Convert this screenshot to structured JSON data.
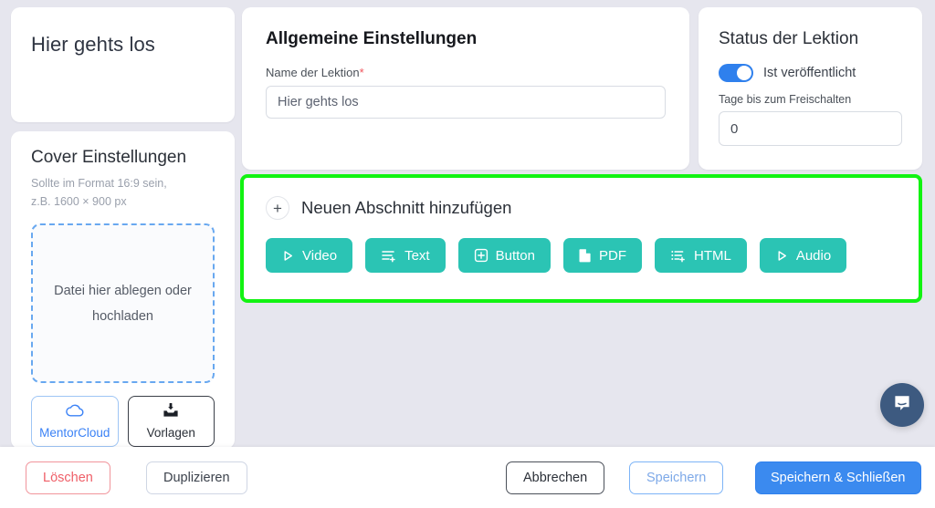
{
  "lesson": {
    "title": "Hier gehts los"
  },
  "cover": {
    "heading": "Cover Einstellungen",
    "hint_line1": "Sollte im Format 16:9 sein,",
    "hint_line2": "z.B. 1600 × 900 px",
    "dropzone_text": "Datei hier ablegen oder hochladen",
    "buttons": [
      {
        "label": "MentorCloud",
        "icon": "cloud-icon"
      },
      {
        "label": "Vorlagen",
        "icon": "template-upload-icon"
      }
    ]
  },
  "general": {
    "heading": "Allgemeine Einstellungen",
    "name_label": "Name der Lektion",
    "required_marker": "*",
    "name_value": "Hier gehts los",
    "name_placeholder": "Name der Lektion"
  },
  "status": {
    "heading": "Status der Lektion",
    "publish_label": "Ist veröffentlicht",
    "publish_on": true,
    "days_label": "Tage bis zum Freischalten",
    "days_value": "0",
    "days_placeholder": "0"
  },
  "add_section": {
    "label": "Neuen Abschnitt hinzufügen",
    "plus_glyph": "+",
    "highlight_color": "#12f312",
    "button_color": "#2bc4b4",
    "buttons": [
      {
        "label": "Video",
        "icon": "play-icon"
      },
      {
        "label": "Text",
        "icon": "text-lines-plus-icon"
      },
      {
        "label": "Button",
        "icon": "plus-square-icon"
      },
      {
        "label": "PDF",
        "icon": "file-icon"
      },
      {
        "label": "HTML",
        "icon": "bullet-list-plus-icon"
      },
      {
        "label": "Audio",
        "icon": "play-icon"
      }
    ]
  },
  "chat": {
    "icon": "chat-bubble-icon"
  },
  "footer": {
    "delete_label": "Löschen",
    "duplicate_label": "Duplizieren",
    "cancel_label": "Abbrechen",
    "save_label": "Speichern",
    "save_close_label": "Speichern & Schließen"
  },
  "colors": {
    "background": "#e6e6ee",
    "accent_teal": "#2bc4b4",
    "accent_blue": "#3b8aef",
    "danger_red": "#ef5f68",
    "highlight_green": "#12f312"
  }
}
